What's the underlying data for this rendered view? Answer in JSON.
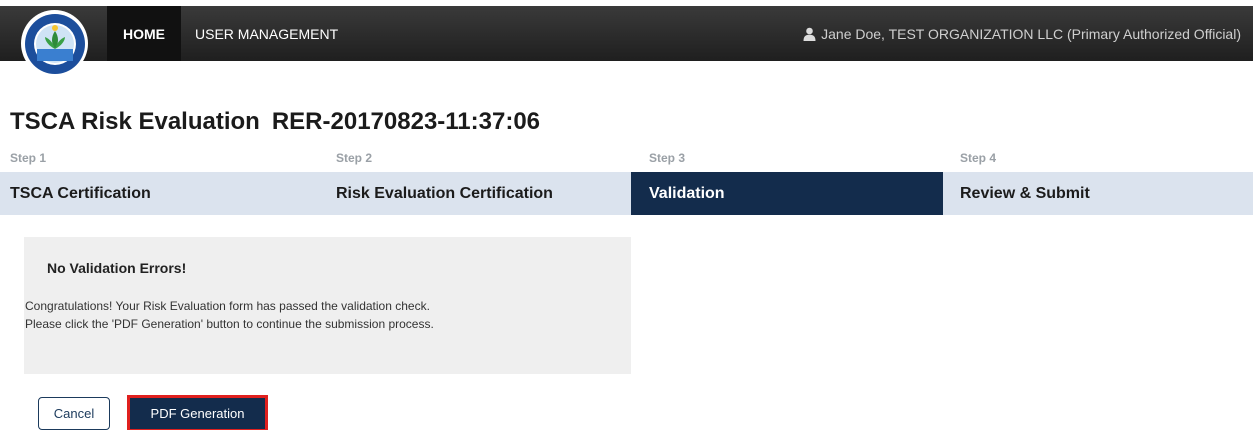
{
  "nav": {
    "home_label": "HOME",
    "user_management_label": "USER MANAGEMENT",
    "user_text": "Jane Doe, TEST ORGANIZATION LLC (Primary Authorized Official)"
  },
  "title": {
    "main": "TSCA Risk Evaluation",
    "record_id": "RER-20170823-11:37:06"
  },
  "steps": [
    {
      "label": "Step 1",
      "name": "TSCA Certification",
      "active": false
    },
    {
      "label": "Step 2",
      "name": "Risk Evaluation Certification",
      "active": false
    },
    {
      "label": "Step 3",
      "name": "Validation",
      "active": true
    },
    {
      "label": "Step 4",
      "name": "Review & Submit",
      "active": false
    }
  ],
  "validation": {
    "heading": "No Validation Errors!",
    "line1": "Congratulations! Your Risk Evaluation form has passed the validation check.",
    "line2": "Please click the 'PDF Generation' button to continue the submission process."
  },
  "buttons": {
    "cancel_label": "Cancel",
    "pdf_label": "PDF Generation"
  },
  "colors": {
    "active_step": "#132c4c",
    "step_bar": "#dbe3ee",
    "highlight": "#e0201e"
  },
  "icons": {
    "logo": "epa-seal-logo",
    "user": "user-icon"
  }
}
